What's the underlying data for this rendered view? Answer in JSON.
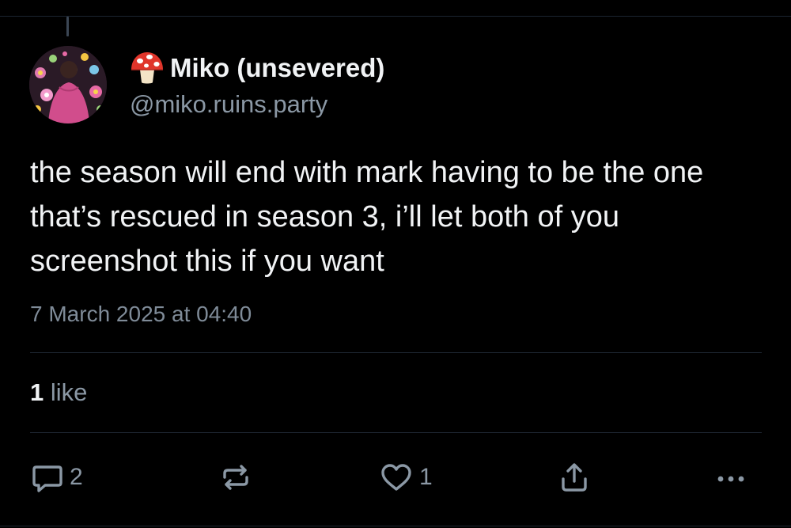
{
  "post": {
    "author": {
      "display_name": "Miko (unsevered)",
      "handle": "@miko.ruins.party"
    },
    "text": "the season will end with mark having to be the one that’s rescued in season 3, i’ll let both of you screenshot this if you want",
    "timestamp": "7 March 2025 at 04:40"
  },
  "stats": {
    "likes_count": "1",
    "likes_label": "like"
  },
  "actions": {
    "reply_count": "2",
    "like_count": "1"
  },
  "icons": {
    "name_emoji": "mushroom-icon",
    "reply": "reply-icon",
    "repost": "repost-icon",
    "like": "heart-icon",
    "share": "share-icon",
    "more": "more-icon"
  },
  "colors": {
    "background": "#000000",
    "text_primary": "#f1f3f5",
    "text_secondary": "#8b98a5",
    "divider": "#1e2732"
  }
}
